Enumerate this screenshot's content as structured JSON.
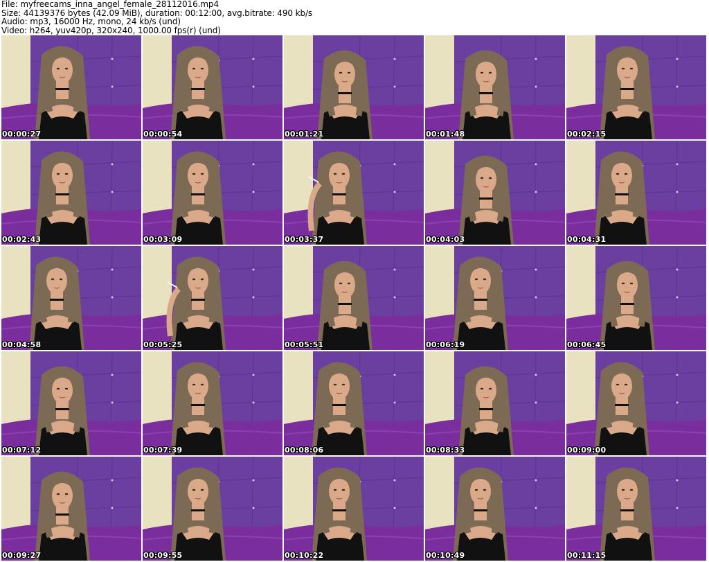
{
  "header": {
    "file_line": "File: myfreecams_inna_angel_female_28112016.mp4",
    "size_line": "Size: 44139376 bytes (42.09 MiB), duration: 00:12:00, avg.bitrate: 490 kb/s",
    "audio_line": "Audio: mp3, 16000 Hz, mono, 24 kb/s (und)",
    "video_line": "Video: h264, yuv420p, 320x240, 1000.00 fps(r) (und)"
  },
  "colors": {
    "wall_purple": "#6b3fa0",
    "couch_purple": "#7a2d9c",
    "light_panel": "#e8e2c0",
    "hair": "#7d6a55",
    "skin": "#d9a98a",
    "clothing": "#111111"
  },
  "thumbnails": [
    {
      "timestamp": "00:00:27",
      "pose": "center",
      "cigarette": false
    },
    {
      "timestamp": "00:00:54",
      "pose": "left",
      "cigarette": false
    },
    {
      "timestamp": "00:01:21",
      "pose": "down",
      "cigarette": false
    },
    {
      "timestamp": "00:01:48",
      "pose": "down",
      "cigarette": false
    },
    {
      "timestamp": "00:02:15",
      "pose": "center",
      "cigarette": false
    },
    {
      "timestamp": "00:02:43",
      "pose": "center",
      "cigarette": false
    },
    {
      "timestamp": "00:03:09",
      "pose": "left",
      "cigarette": false
    },
    {
      "timestamp": "00:03:37",
      "pose": "left",
      "cigarette": true
    },
    {
      "timestamp": "00:04:03",
      "pose": "down",
      "cigarette": false
    },
    {
      "timestamp": "00:04:31",
      "pose": "left",
      "cigarette": false
    },
    {
      "timestamp": "00:04:58",
      "pose": "left",
      "cigarette": false
    },
    {
      "timestamp": "00:05:25",
      "pose": "left",
      "cigarette": true
    },
    {
      "timestamp": "00:05:51",
      "pose": "down",
      "cigarette": false
    },
    {
      "timestamp": "00:06:19",
      "pose": "left",
      "cigarette": false
    },
    {
      "timestamp": "00:06:45",
      "pose": "down",
      "cigarette": false
    },
    {
      "timestamp": "00:07:12",
      "pose": "down",
      "cigarette": false
    },
    {
      "timestamp": "00:07:39",
      "pose": "left",
      "cigarette": false
    },
    {
      "timestamp": "00:08:06",
      "pose": "left",
      "cigarette": false
    },
    {
      "timestamp": "00:08:33",
      "pose": "down",
      "cigarette": false
    },
    {
      "timestamp": "00:09:00",
      "pose": "left",
      "cigarette": false
    },
    {
      "timestamp": "00:09:27",
      "pose": "down",
      "cigarette": false
    },
    {
      "timestamp": "00:09:55",
      "pose": "left",
      "cigarette": false
    },
    {
      "timestamp": "00:10:22",
      "pose": "left",
      "cigarette": false
    },
    {
      "timestamp": "00:10:49",
      "pose": "left",
      "cigarette": false
    },
    {
      "timestamp": "00:11:15",
      "pose": "center",
      "cigarette": false
    }
  ]
}
